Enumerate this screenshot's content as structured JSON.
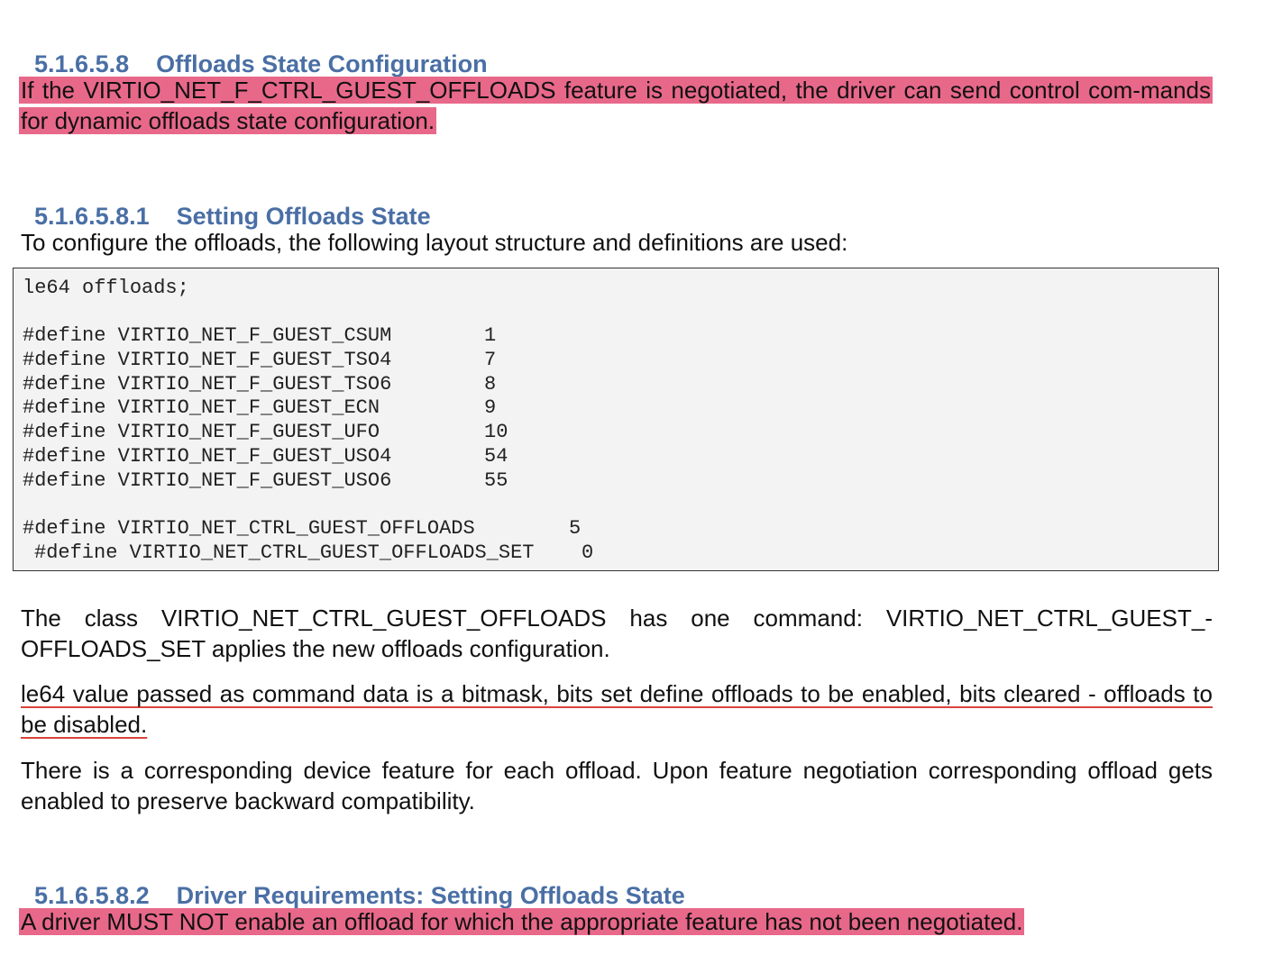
{
  "sections": {
    "s1": {
      "number": "5.1.6.5.8",
      "title": "Offloads State Configuration",
      "para": "If the VIRTIO_NET_F_CTRL_GUEST_OFFLOADS feature is negotiated, the driver can send control com-mands for dynamic offloads state configuration."
    },
    "s2": {
      "number": "5.1.6.5.8.1",
      "title": "Setting Offloads State",
      "intro": "To configure the offloads, the following layout structure and definitions are used:"
    },
    "s3": {
      "number": "5.1.6.5.8.2",
      "title": "Driver Requirements: Setting Offloads State",
      "para": "A driver MUST NOT enable an offload for which the appropriate feature has not been negotiated."
    }
  },
  "code": {
    "struct_line": "le64 offloads;",
    "defines": [
      {
        "name": "#define VIRTIO_NET_F_GUEST_CSUM",
        "value": "1"
      },
      {
        "name": "#define VIRTIO_NET_F_GUEST_TSO4",
        "value": "7"
      },
      {
        "name": "#define VIRTIO_NET_F_GUEST_TSO6",
        "value": "8"
      },
      {
        "name": "#define VIRTIO_NET_F_GUEST_ECN",
        "value": "9"
      },
      {
        "name": "#define VIRTIO_NET_F_GUEST_UFO",
        "value": "10"
      },
      {
        "name": "#define VIRTIO_NET_F_GUEST_USO4",
        "value": "54"
      },
      {
        "name": "#define VIRTIO_NET_F_GUEST_USO6",
        "value": "55"
      }
    ],
    "ctrl_defines": [
      {
        "name": "#define VIRTIO_NET_CTRL_GUEST_OFFLOADS",
        "value": "5"
      },
      {
        "name": "#define VIRTIO_NET_CTRL_GUEST_OFFLOADS_SET",
        "value": "0"
      }
    ]
  },
  "body": {
    "p1": "The class VIRTIO_NET_CTRL_GUEST_OFFLOADS has one command: VIRTIO_NET_CTRL_GUEST_-OFFLOADS_SET applies the new offloads configuration.",
    "p2": "le64 value passed as command data is a bitmask, bits set define offloads to be enabled, bits cleared - offloads to be disabled.",
    "p3": "There is a corresponding device feature for each offload.  Upon feature negotiation corresponding offload gets enabled to preserve backward compatibility."
  },
  "colors": {
    "heading": "#4a6fa5",
    "highlight": "#e8688a",
    "underline": "#d9443a",
    "code_bg": "#f3f3f3"
  }
}
